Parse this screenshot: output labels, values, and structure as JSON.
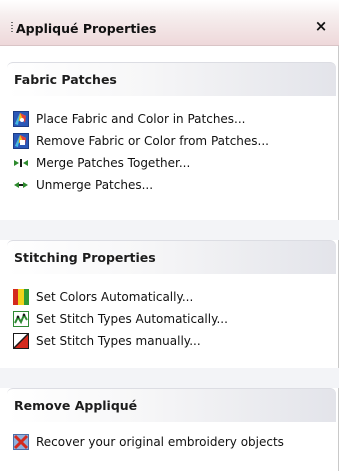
{
  "panel": {
    "title": "Appliqué Properties",
    "close_glyph": "×"
  },
  "groups": [
    {
      "header": "Fabric Patches",
      "items": [
        {
          "label": "Place Fabric and Color in Patches...",
          "icon": "fabric-color-icon"
        },
        {
          "label": "Remove Fabric or Color from Patches...",
          "icon": "fabric-color-remove-icon"
        },
        {
          "label": "Merge Patches Together...",
          "icon": "merge-arrows-icon"
        },
        {
          "label": "Unmerge Patches...",
          "icon": "unmerge-arrows-icon"
        }
      ]
    },
    {
      "header": "Stitching Properties",
      "items": [
        {
          "label": "Set Colors Automatically...",
          "icon": "color-bars-icon"
        },
        {
          "label": "Set Stitch Types Automatically...",
          "icon": "stitch-auto-icon"
        },
        {
          "label": "Set Stitch Types manually...",
          "icon": "stitch-manual-icon"
        }
      ]
    },
    {
      "header": "Remove Appliqué",
      "items": [
        {
          "label": "Recover your original embroidery objects",
          "icon": "recover-x-icon"
        }
      ]
    }
  ]
}
